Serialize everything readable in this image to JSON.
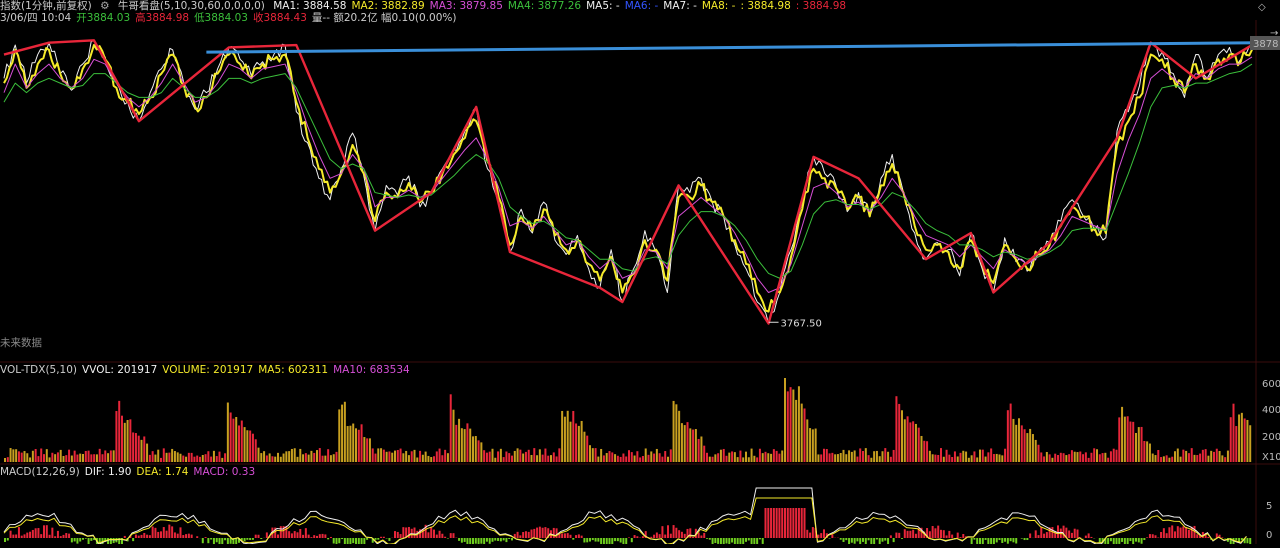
{
  "colors": {
    "up": "#e8263a",
    "down": "#6fcf1f",
    "yellow": "#f5ea2a",
    "white": "#f0f0f0",
    "green": "#3bbf3b",
    "magenta": "#d64fd6",
    "blue": "#3a8fd9",
    "grid": "#2a0a0a",
    "orange": "#f0a020"
  },
  "header": {
    "title": "指数(1分钟,前复权)",
    "indicator": "牛哥看盘(5,10,30,60,0,0,0,0)",
    "ma": [
      {
        "label": "MA1: 3884.58",
        "color": "#f0f0f0"
      },
      {
        "label": "MA2: 3882.89",
        "color": "#f5ea2a"
      },
      {
        "label": "MA3: 3879.85",
        "color": "#d64fd6"
      },
      {
        "label": "MA4: 3877.26",
        "color": "#3bbf3b"
      },
      {
        "label": "MA5: -",
        "color": "#f0f0f0"
      },
      {
        "label": "MA6: -",
        "color": "#3355ff"
      },
      {
        "label": "MA7: -",
        "color": "#f0f0f0"
      },
      {
        "label": "MA8: -",
        "color": "#f5ea2a"
      },
      {
        "label": ": 3884.98",
        "color": "#f5ea2a"
      },
      {
        "label": ": 3884.98",
        "color": "#e8263a"
      }
    ],
    "quote": [
      {
        "label": "3/06/四 10:04",
        "color": "#cccccc"
      },
      {
        "label": "开3884.03",
        "color": "#3bbf3b"
      },
      {
        "label": "高3884.98",
        "color": "#e8263a"
      },
      {
        "label": "低3884.03",
        "color": "#3bbf3b"
      },
      {
        "label": "收3884.43",
        "color": "#e8263a"
      },
      {
        "label": "量-- 额20.2亿 幅0.10(0.00%)",
        "color": "#cccccc"
      }
    ]
  },
  "price_panel": {
    "min_label": "3767.50",
    "price_tag": "3878",
    "top_right_marks": [
      "◇",
      "→"
    ],
    "future_label": "未来数据"
  },
  "volume_panel": {
    "header": [
      {
        "label": "VOL-TDX(5,10)",
        "color": "#cccccc"
      },
      {
        "label": "VVOL: 201917",
        "color": "#f0f0f0"
      },
      {
        "label": "VOLUME: 201917",
        "color": "#f5ea2a"
      },
      {
        "label": "MA5: 602311",
        "color": "#f5ea2a"
      },
      {
        "label": "MA10: 683534",
        "color": "#d64fd6"
      }
    ],
    "ticks": [
      "600",
      "400",
      "200",
      "X100"
    ]
  },
  "macd_panel": {
    "header": [
      {
        "label": "MACD(12,26,9)",
        "color": "#cccccc"
      },
      {
        "label": "DIF: 1.90",
        "color": "#f0f0f0"
      },
      {
        "label": "DEA: 1.74",
        "color": "#f5ea2a"
      },
      {
        "label": "MACD: 0.33",
        "color": "#d64fd6"
      }
    ],
    "ticks": [
      "5",
      "0"
    ]
  },
  "chart_data": {
    "type": "line",
    "title": "",
    "xlabel": "",
    "ylabel": "",
    "y_range_price": [
      3755,
      3892
    ],
    "x_count": 112,
    "series": [
      {
        "name": "",
        "values": [
          3870,
          3884,
          3868,
          3880,
          3885,
          3872,
          3865,
          3876,
          3886,
          3879,
          3868,
          3860,
          3852,
          3864,
          3874,
          3882,
          3868,
          3857,
          3864,
          3874,
          3883,
          3878,
          3871,
          3877,
          3880,
          3884,
          3856,
          3843,
          3828,
          3819,
          3832,
          3847,
          3829,
          3806,
          3825,
          3821,
          3829,
          3816,
          3822,
          3832,
          3840,
          3848,
          3858,
          3832,
          3817,
          3797,
          3815,
          3805,
          3818,
          3802,
          3796,
          3804,
          3790,
          3782,
          3798,
          3776,
          3790,
          3806,
          3797,
          3780,
          3825,
          3822,
          3828,
          3818,
          3812,
          3800,
          3790,
          3776,
          3767,
          3780,
          3798,
          3818,
          3837,
          3830,
          3825,
          3814,
          3822,
          3812,
          3828,
          3838,
          3822,
          3805,
          3794,
          3801,
          3798,
          3787,
          3805,
          3790,
          3780,
          3803,
          3793,
          3789,
          3797,
          3801,
          3810,
          3819,
          3812,
          3806,
          3803,
          3848,
          3856,
          3867,
          3885,
          3881,
          3872,
          3862,
          3880,
          3870,
          3880,
          3883,
          3878,
          3884
        ]
      },
      {
        "name": "",
        "values": [
          3868,
          3882,
          3866,
          3876,
          3882,
          3872,
          3866,
          3874,
          3884,
          3878,
          3866,
          3860,
          3855,
          3862,
          3872,
          3880,
          3867,
          3858,
          3862,
          3872,
          3880,
          3876,
          3870,
          3876,
          3878,
          3880,
          3860,
          3845,
          3832,
          3822,
          3830,
          3842,
          3830,
          3810,
          3822,
          3820,
          3826,
          3818,
          3822,
          3830,
          3838,
          3845,
          3852,
          3835,
          3820,
          3800,
          3812,
          3806,
          3815,
          3804,
          3798,
          3802,
          3792,
          3785,
          3795,
          3780,
          3788,
          3802,
          3798,
          3785,
          3820,
          3820,
          3825,
          3818,
          3812,
          3802,
          3792,
          3780,
          3772,
          3780,
          3795,
          3815,
          3832,
          3828,
          3824,
          3815,
          3820,
          3812,
          3825,
          3834,
          3822,
          3808,
          3798,
          3800,
          3797,
          3790,
          3802,
          3792,
          3784,
          3800,
          3794,
          3790,
          3796,
          3800,
          3808,
          3816,
          3812,
          3807,
          3805,
          3842,
          3852,
          3862,
          3880,
          3878,
          3870,
          3864,
          3876,
          3870,
          3878,
          3880,
          3877,
          3882
        ]
      },
      {
        "name": "",
        "values": [
          3864,
          3876,
          3866,
          3872,
          3876,
          3870,
          3866,
          3870,
          3878,
          3876,
          3868,
          3862,
          3858,
          3862,
          3868,
          3876,
          3868,
          3860,
          3862,
          3868,
          3876,
          3874,
          3870,
          3874,
          3875,
          3876,
          3864,
          3850,
          3838,
          3828,
          3830,
          3838,
          3832,
          3816,
          3820,
          3820,
          3823,
          3820,
          3822,
          3828,
          3834,
          3840,
          3845,
          3836,
          3824,
          3808,
          3810,
          3807,
          3812,
          3806,
          3800,
          3802,
          3795,
          3790,
          3794,
          3786,
          3788,
          3798,
          3797,
          3790,
          3812,
          3816,
          3820,
          3816,
          3812,
          3805,
          3796,
          3786,
          3780,
          3782,
          3792,
          3808,
          3824,
          3826,
          3822,
          3816,
          3818,
          3814,
          3820,
          3828,
          3822,
          3812,
          3804,
          3802,
          3800,
          3795,
          3800,
          3795,
          3790,
          3798,
          3795,
          3792,
          3795,
          3798,
          3804,
          3812,
          3810,
          3808,
          3806,
          3830,
          3844,
          3855,
          3870,
          3874,
          3870,
          3866,
          3872,
          3870,
          3874,
          3876,
          3876,
          3879
        ]
      },
      {
        "name": "",
        "values": [
          3860,
          3868,
          3864,
          3868,
          3870,
          3868,
          3866,
          3867,
          3872,
          3872,
          3868,
          3864,
          3862,
          3862,
          3864,
          3870,
          3866,
          3862,
          3862,
          3865,
          3870,
          3870,
          3868,
          3870,
          3871,
          3872,
          3866,
          3856,
          3846,
          3836,
          3832,
          3834,
          3832,
          3822,
          3821,
          3820,
          3821,
          3820,
          3821,
          3825,
          3829,
          3834,
          3838,
          3835,
          3828,
          3816,
          3812,
          3809,
          3810,
          3807,
          3803,
          3802,
          3798,
          3794,
          3794,
          3790,
          3789,
          3794,
          3795,
          3792,
          3804,
          3810,
          3814,
          3814,
          3812,
          3808,
          3802,
          3794,
          3788,
          3786,
          3789,
          3800,
          3813,
          3818,
          3819,
          3817,
          3817,
          3815,
          3817,
          3822,
          3820,
          3815,
          3809,
          3806,
          3804,
          3800,
          3800,
          3798,
          3795,
          3797,
          3796,
          3794,
          3795,
          3797,
          3800,
          3806,
          3807,
          3807,
          3806,
          3818,
          3830,
          3843,
          3858,
          3866,
          3867,
          3866,
          3868,
          3868,
          3870,
          3872,
          3873,
          3876
        ]
      }
    ],
    "zigzag_red": [
      [
        0,
        3880
      ],
      [
        4,
        3885
      ],
      [
        8,
        3886
      ],
      [
        12,
        3852
      ],
      [
        20,
        3883
      ],
      [
        26,
        3884
      ],
      [
        33,
        3806
      ],
      [
        38,
        3822
      ],
      [
        42,
        3858
      ],
      [
        45,
        3797
      ],
      [
        53,
        3782
      ],
      [
        55,
        3776
      ],
      [
        60,
        3825
      ],
      [
        68,
        3767
      ],
      [
        72,
        3837
      ],
      [
        76,
        3828
      ],
      [
        82,
        3794
      ],
      [
        86,
        3805
      ],
      [
        88,
        3780
      ],
      [
        93,
        3801
      ],
      [
        99,
        3845
      ],
      [
        102,
        3885
      ],
      [
        106,
        3870
      ],
      [
        111,
        3884
      ]
    ],
    "trend_line": [
      [
        18,
        3881
      ],
      [
        111,
        3885
      ]
    ],
    "min_point": {
      "x": 68,
      "y": 3767.5
    }
  }
}
